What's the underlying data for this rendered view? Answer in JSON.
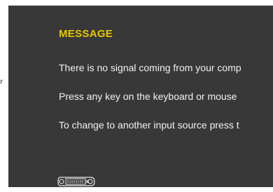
{
  "fragments": {
    "left_edge_text": "r"
  },
  "osd": {
    "title": "MESSAGE",
    "lines": [
      "There is no signal coming from your comp",
      "Press any key on the keyboard or mouse",
      "To change to another input source press t"
    ],
    "icon": "dvi-connector-icon",
    "colors": {
      "panel_background": "#383838",
      "title": "#e8c800",
      "text": "#f2f2f2"
    }
  }
}
